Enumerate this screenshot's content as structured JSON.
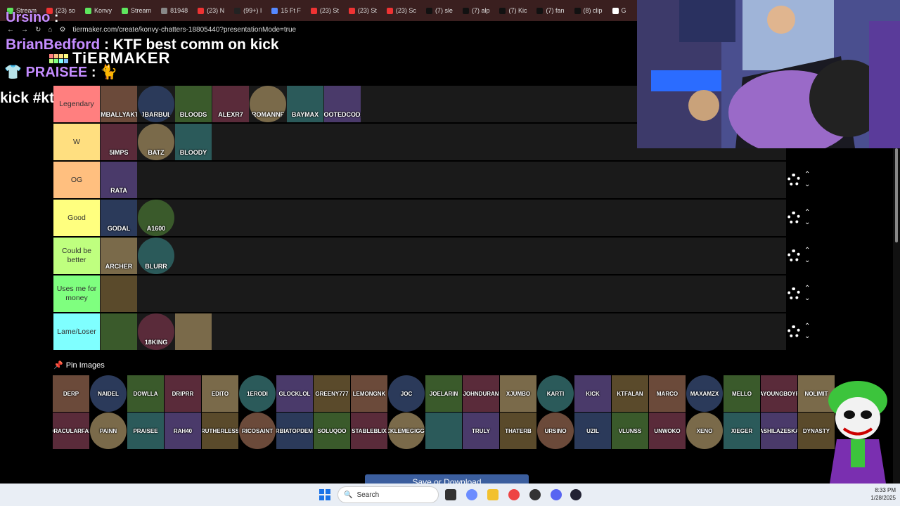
{
  "browser": {
    "tabs": [
      {
        "label": "Stream",
        "color": "#5ee65e"
      },
      {
        "label": "(23) so",
        "color": "#e33"
      },
      {
        "label": "Konvy",
        "color": "#5ee65e"
      },
      {
        "label": "Stream",
        "color": "#5ee65e"
      },
      {
        "label": "81948",
        "color": "#888"
      },
      {
        "label": "(23) N",
        "color": "#e33"
      },
      {
        "label": "(99+) I",
        "color": "#222"
      },
      {
        "label": "15 Ft F",
        "color": "#58f"
      },
      {
        "label": "(23) St",
        "color": "#e33"
      },
      {
        "label": "(23) St",
        "color": "#e33"
      },
      {
        "label": "(23) Sc",
        "color": "#e33"
      },
      {
        "label": "(7) sle",
        "color": "#111"
      },
      {
        "label": "(7) alp",
        "color": "#111"
      },
      {
        "label": "(7) Kic",
        "color": "#111"
      },
      {
        "label": "(7) fan",
        "color": "#111"
      },
      {
        "label": "(8) clip",
        "color": "#111"
      },
      {
        "label": "G",
        "color": "#fff"
      }
    ],
    "url": "tiermaker.com/create/konvy-chatters-18805440?presentationMode=true"
  },
  "overlay": {
    "chat1_user": "Ursino",
    "chat1_msg": ":",
    "chat2_user": "BrianBedford",
    "chat2_msg": ": KTF best comm on kick",
    "chat3_user": "PRAISEE",
    "chat3_msg": ": 🐈",
    "chat4": "kick #ktf"
  },
  "logo": {
    "text": "TiERMAKER"
  },
  "tiers": [
    {
      "label": "Legendary",
      "color": "#ff7f7f",
      "items": [
        "IMBALLYAKT",
        "JBARBUL",
        "BLOODS",
        "ALEXR7",
        "BROMANNEY",
        "BAYMAX",
        "LOOTEDCODA"
      ]
    },
    {
      "label": "W",
      "color": "#ffdf80",
      "items": [
        "5IMPS",
        "BATZ",
        "BLOODY"
      ]
    },
    {
      "label": "OG",
      "color": "#ffbf7f",
      "items": [
        "RATA"
      ]
    },
    {
      "label": "Good",
      "color": "#ffff7f",
      "items": [
        "GODAL",
        "A1600"
      ]
    },
    {
      "label": "Could be better",
      "color": "#bfff7f",
      "items": [
        "ARCHER",
        "BLURR"
      ]
    },
    {
      "label": "Uses me for money",
      "color": "#7fff7f",
      "items": [
        ""
      ]
    },
    {
      "label": "Lame/Loser",
      "color": "#7fffff",
      "items": [
        "",
        "18KING",
        ""
      ]
    }
  ],
  "pin_label": "Pin Images",
  "pool_row1": [
    "DERP",
    "NAIDEL",
    "DOWLLA",
    "DRIPRR",
    "EDITO",
    "1ERODI",
    "GLOCKLOL",
    "GREENY777",
    "LEMONGNK",
    "JOC",
    "JOELARIN",
    "JOHNDURAN",
    "XJUMBO",
    "KARTI",
    "KICK",
    "KTFALAN",
    "MARCO",
    "MAXAMZX",
    "MELLO",
    "NBAYOUNGBOYFAN",
    "NOLIMIT"
  ],
  "pool_row2": [
    "ORACULARFAN",
    "PAINN",
    "PRAISEE",
    "RAH40",
    "RUTHERLESS",
    "RICOSAINT",
    "SERBIATOPDEMON",
    "SOLUQOO",
    "STABLEBLIX",
    "TICKLEMEGIGGLE",
    "",
    "TRULY",
    "THATERB",
    "URSINO",
    "UZIL",
    "VLUNSS",
    "UNWOKO",
    "XENO",
    "XIEGER",
    "SASHILAZESKAY",
    "DYNASTY"
  ],
  "save_label": "Save or Download",
  "taskbar": {
    "search_placeholder": "Search",
    "time": "8:33 PM",
    "date": "1/28/2025"
  },
  "colors": {
    "accent": "#3b5e9e",
    "chat_name": "#c48cff"
  }
}
